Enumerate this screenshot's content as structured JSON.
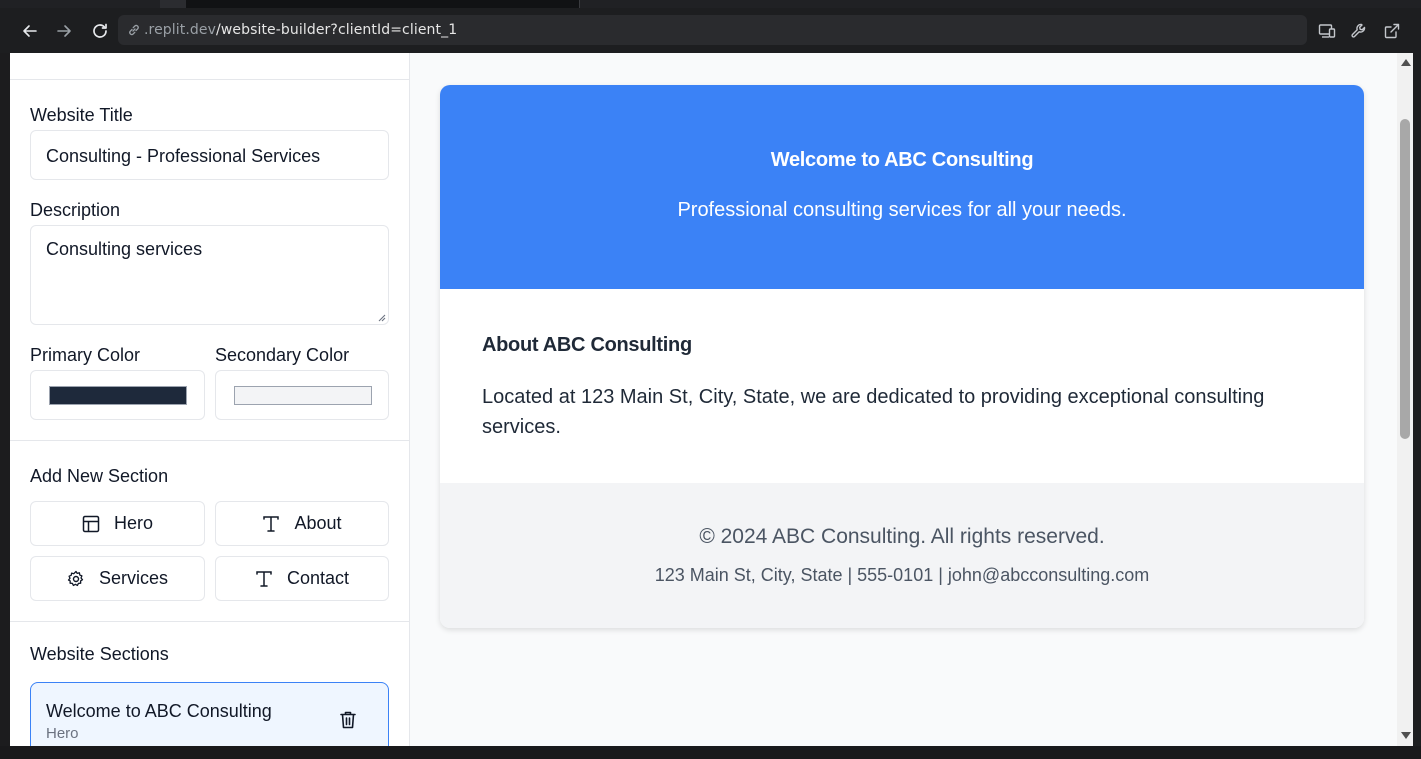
{
  "browser": {
    "url_prefix": ".replit.dev",
    "url_path": "/website-builder?clientId=client_1"
  },
  "editor": {
    "website_title_label": "Website Title",
    "website_title_value": "Consulting - Professional Services",
    "description_label": "Description",
    "description_value": "Consulting services",
    "primary_color_label": "Primary Color",
    "primary_color_value": "#1e293b",
    "secondary_color_label": "Secondary Color",
    "secondary_color_value": "#f3f4f6",
    "add_section_label": "Add New Section",
    "section_buttons": [
      {
        "label": "Hero",
        "icon": "layout-icon"
      },
      {
        "label": "About",
        "icon": "text-icon"
      },
      {
        "label": "Services",
        "icon": "gear-icon"
      },
      {
        "label": "Contact",
        "icon": "text-icon"
      }
    ],
    "website_sections_label": "Website Sections",
    "sections": [
      {
        "title": "Welcome to ABC Consulting",
        "type": "Hero"
      }
    ]
  },
  "preview": {
    "hero_title": "Welcome to ABC Consulting",
    "hero_subtitle": "Professional consulting services for all your needs.",
    "hero_color": "#3b82f6",
    "about_title": "About ABC Consulting",
    "about_text": "Located at 123 Main St, City, State, we are dedicated to providing exceptional consulting services.",
    "footer_copyright": "© 2024 ABC Consulting. All rights reserved.",
    "footer_contact": "123 Main St, City, State | 555-0101 | john@abcconsulting.com"
  }
}
